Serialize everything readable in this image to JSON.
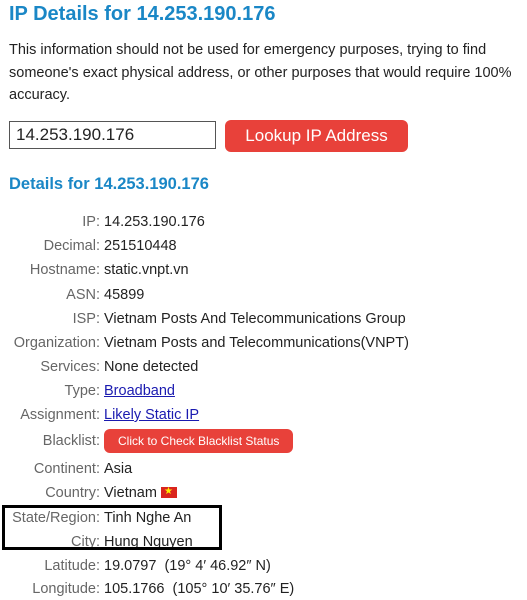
{
  "header": {
    "title": "IP Details for 14.253.190.176"
  },
  "notice": "This information should not be used for emergency purposes, trying to find someone's exact physical address, or other purposes that would require 100% accuracy.",
  "lookup": {
    "input_value": "14.253.190.176",
    "button_label": "Lookup IP Address"
  },
  "details": {
    "title": "Details for 14.253.190.176",
    "ip_label": "IP:",
    "ip": "14.253.190.176",
    "decimal_label": "Decimal:",
    "decimal": "251510448",
    "hostname_label": "Hostname:",
    "hostname": "static.vnpt.vn",
    "asn_label": "ASN:",
    "asn": "45899",
    "isp_label": "ISP:",
    "isp": "Vietnam Posts And Telecommunications Group",
    "organization_label": "Organization:",
    "organization": "Vietnam Posts and Telecommunications(VNPT)",
    "services_label": "Services:",
    "services": "None detected",
    "type_label": "Type:",
    "type": "Broadband",
    "assignment_label": "Assignment:",
    "assignment": "Likely Static IP",
    "blacklist_label": "Blacklist:",
    "blacklist_button": "Click to Check Blacklist Status",
    "continent_label": "Continent:",
    "continent": "Asia",
    "country_label": "Country:",
    "country": "Vietnam",
    "country_flag_icon": "vietnam-flag-icon",
    "state_label": "State/Region:",
    "state": "Tinh Nghe An",
    "city_label": "City:",
    "city": "Hung Nguyen",
    "latitude_label": "Latitude:",
    "latitude": "19.0797  (19° 4′ 46.92″ N)",
    "longitude_label": "Longitude:",
    "longitude": "105.1766  (105° 10′ 35.76″ E)"
  },
  "colors": {
    "heading": "#1a87c6",
    "button": "#e8413a",
    "link": "#1a1ab0",
    "label": "#666666"
  }
}
